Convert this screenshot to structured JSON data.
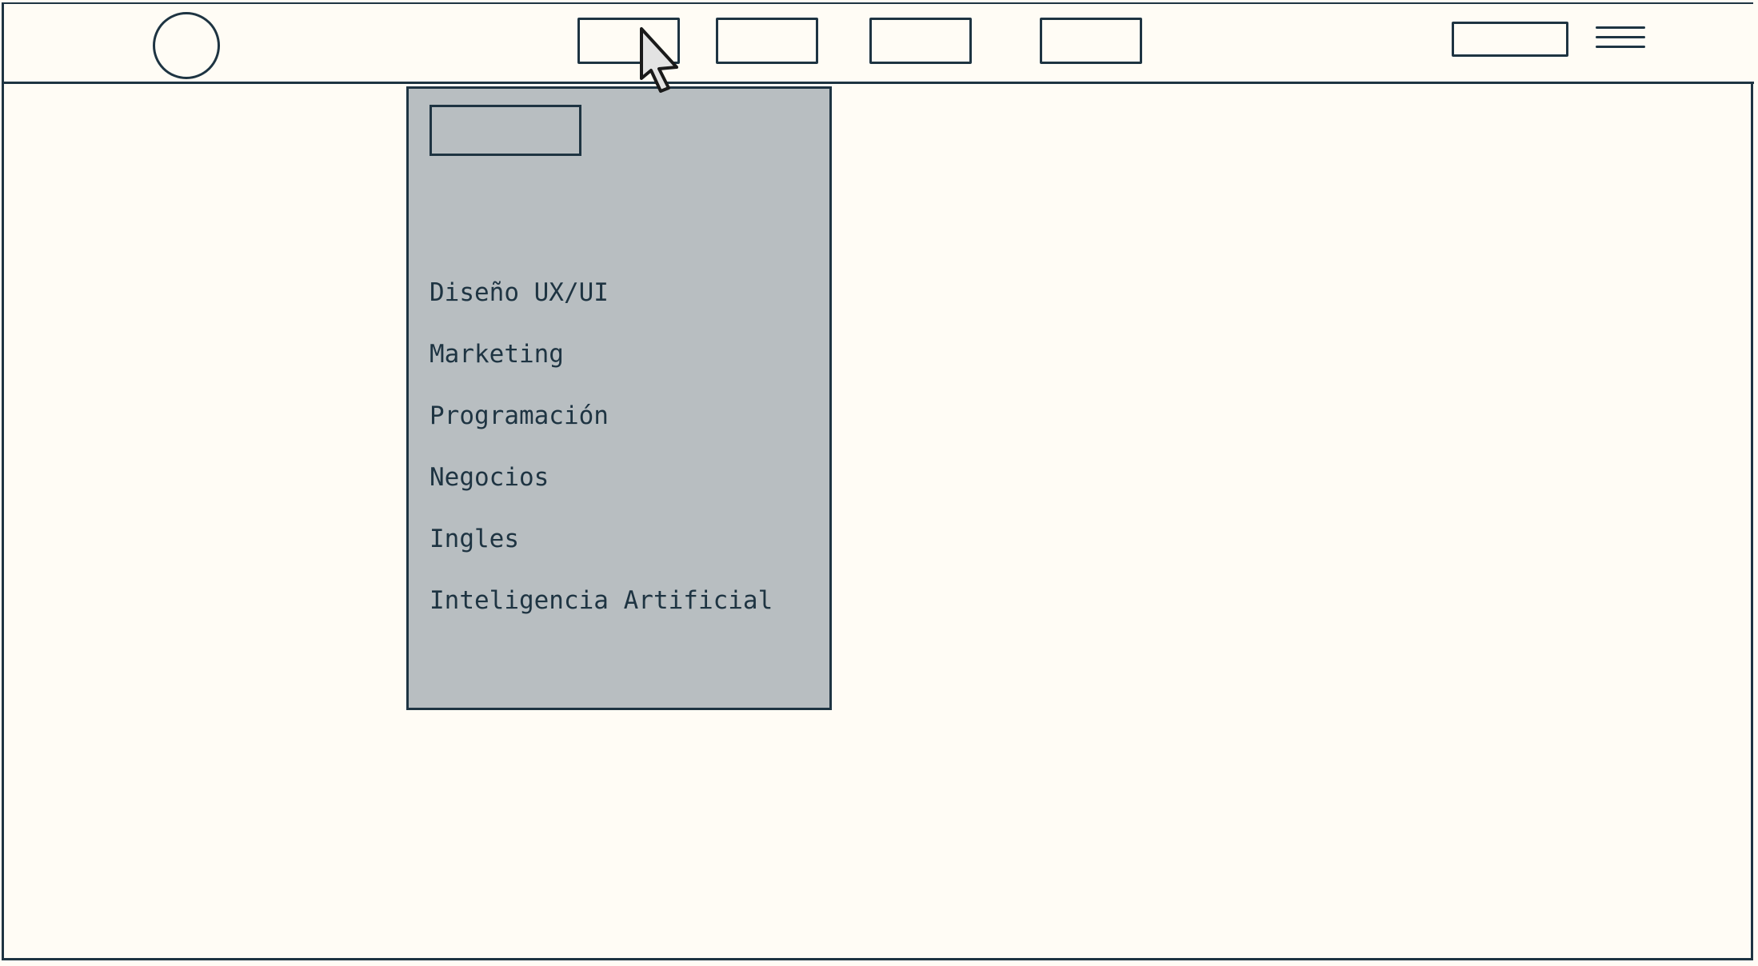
{
  "navbar": {
    "logo_icon": "circle-logo-icon",
    "nav_buttons": [
      "",
      "",
      "",
      ""
    ],
    "action_button": "",
    "menu_icon": "hamburger-icon"
  },
  "dropdown": {
    "header_label": "",
    "items": [
      {
        "label": "Diseño UX/UI"
      },
      {
        "label": "Marketing"
      },
      {
        "label": "Programación"
      },
      {
        "label": "Negocios"
      },
      {
        "label": "Ingles"
      },
      {
        "label": "Inteligencia Artificial"
      }
    ]
  },
  "colors": {
    "ink": "#1e3442",
    "paper": "#fffcf5",
    "dropdown_bg": "#b8bec1",
    "cursor_fill": "#e3e3e3"
  },
  "cursor_icon": "mouse-pointer-icon"
}
